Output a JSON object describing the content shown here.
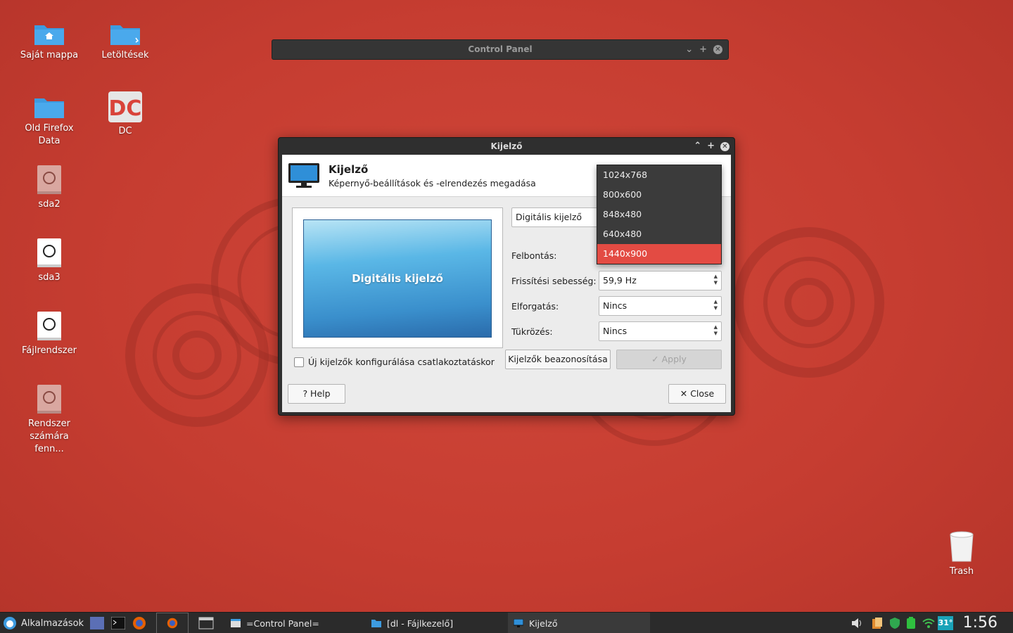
{
  "desktop": {
    "icons": [
      {
        "label": "Saját mappa"
      },
      {
        "label": "Letöltések"
      },
      {
        "label": "Old Firefox Data"
      },
      {
        "label": "DC"
      },
      {
        "label": "sda2"
      },
      {
        "label": "sda3"
      },
      {
        "label": "Fájlrendszer"
      },
      {
        "label": "Rendszer számára fenn..."
      },
      {
        "label": "Trash"
      }
    ]
  },
  "control_panel": {
    "title": "Control Panel"
  },
  "dialog": {
    "window_title": "Kijelző",
    "header_title": "Kijelző",
    "header_subtitle": "Képernyő-beállítások és -elrendezés megadása",
    "preview_label": "Digitális kijelző",
    "display_select": "Digitális kijelző",
    "resolution_label": "Felbontás:",
    "resolution_options": [
      "1024x768",
      "800x600",
      "848x480",
      "640x480",
      "1440x900"
    ],
    "resolution_selected": "1440x900",
    "refresh_label": "Frissítési sebesség:",
    "refresh_value": "59,9 Hz",
    "rotation_label": "Elforgatás:",
    "rotation_value": "Nincs",
    "reflection_label": "Tükrözés:",
    "reflection_value": "Nincs",
    "configure_new_label": "Új kijelzők konfigurálása csatlakoztatáskor",
    "identify_button": "Kijelzők beazonosítása",
    "apply_button": "Apply",
    "help_button": "Help",
    "close_button": "Close"
  },
  "taskbar": {
    "apps_menu": "Alkalmazások",
    "tasks": [
      "=Control Panel=",
      "[dl - Fájlkezelő]",
      "Kijelző"
    ],
    "weather": "31°",
    "clock": "1:56"
  },
  "colors": {
    "accent": "#e34b43",
    "desktop": "#c63d31",
    "folder": "#3d9be0"
  }
}
